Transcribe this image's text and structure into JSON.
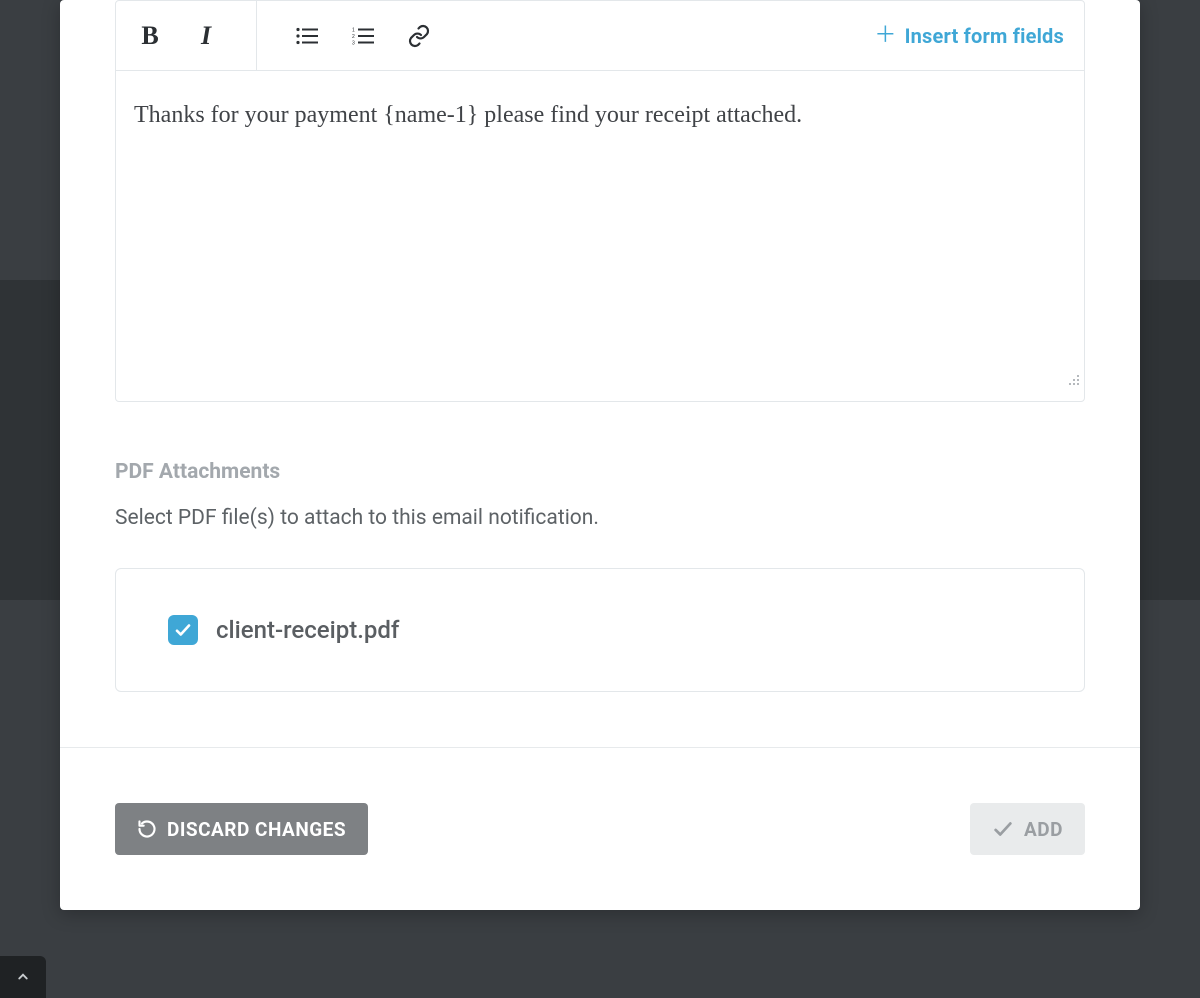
{
  "editor": {
    "toolbar": {
      "bold_label": "B",
      "italic_label": "I"
    },
    "insert_form_fields_label": "Insert form fields",
    "content": "Thanks for your payment {name-1} please find your receipt attached."
  },
  "attachments": {
    "section_title": "PDF Attachments",
    "help_text": "Select PDF file(s) to attach to this email notification.",
    "items": [
      {
        "name": "client-receipt.pdf",
        "checked": true
      }
    ]
  },
  "footer": {
    "discard_label": "DISCARD CHANGES",
    "add_label": "ADD"
  },
  "colors": {
    "accent": "#3fa7d6"
  }
}
